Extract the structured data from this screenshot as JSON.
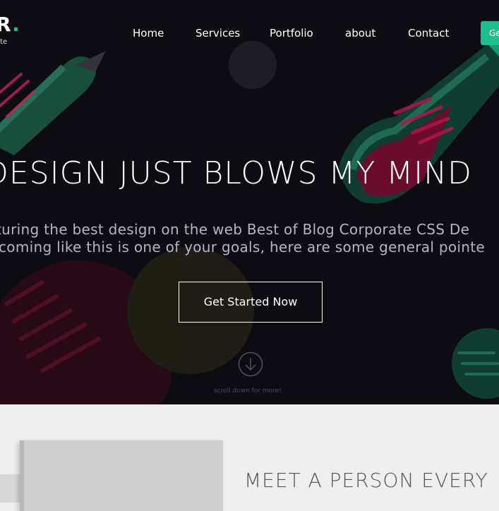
{
  "brand": {
    "logo_text": "R",
    "logo_dot": ".",
    "tagline": "ate"
  },
  "nav": {
    "items": [
      {
        "label": "Home"
      },
      {
        "label": "Services"
      },
      {
        "label": "Portfolio"
      },
      {
        "label": "about"
      },
      {
        "label": "Contact"
      }
    ],
    "cta_label": "Ge"
  },
  "hero": {
    "headline": "DESIGN JUST BLOWS MY MIND",
    "lead_line1": "turing the best design on the web Best of Blog Corporate CSS De",
    "lead_line2": "coming like this is one of your goals, here are some general pointe",
    "cta_label": "Get Started Now",
    "scroll_icon": "arrow-down-circle-icon",
    "scroll_text": "scroll down for more!"
  },
  "section": {
    "heading": "MEET A PERSON EVERY"
  },
  "colors": {
    "hero_bg": "#0d0c12",
    "accent": "#1dbf8e",
    "rocket_red": "#7a0f2e",
    "section_bg": "#efefef"
  }
}
